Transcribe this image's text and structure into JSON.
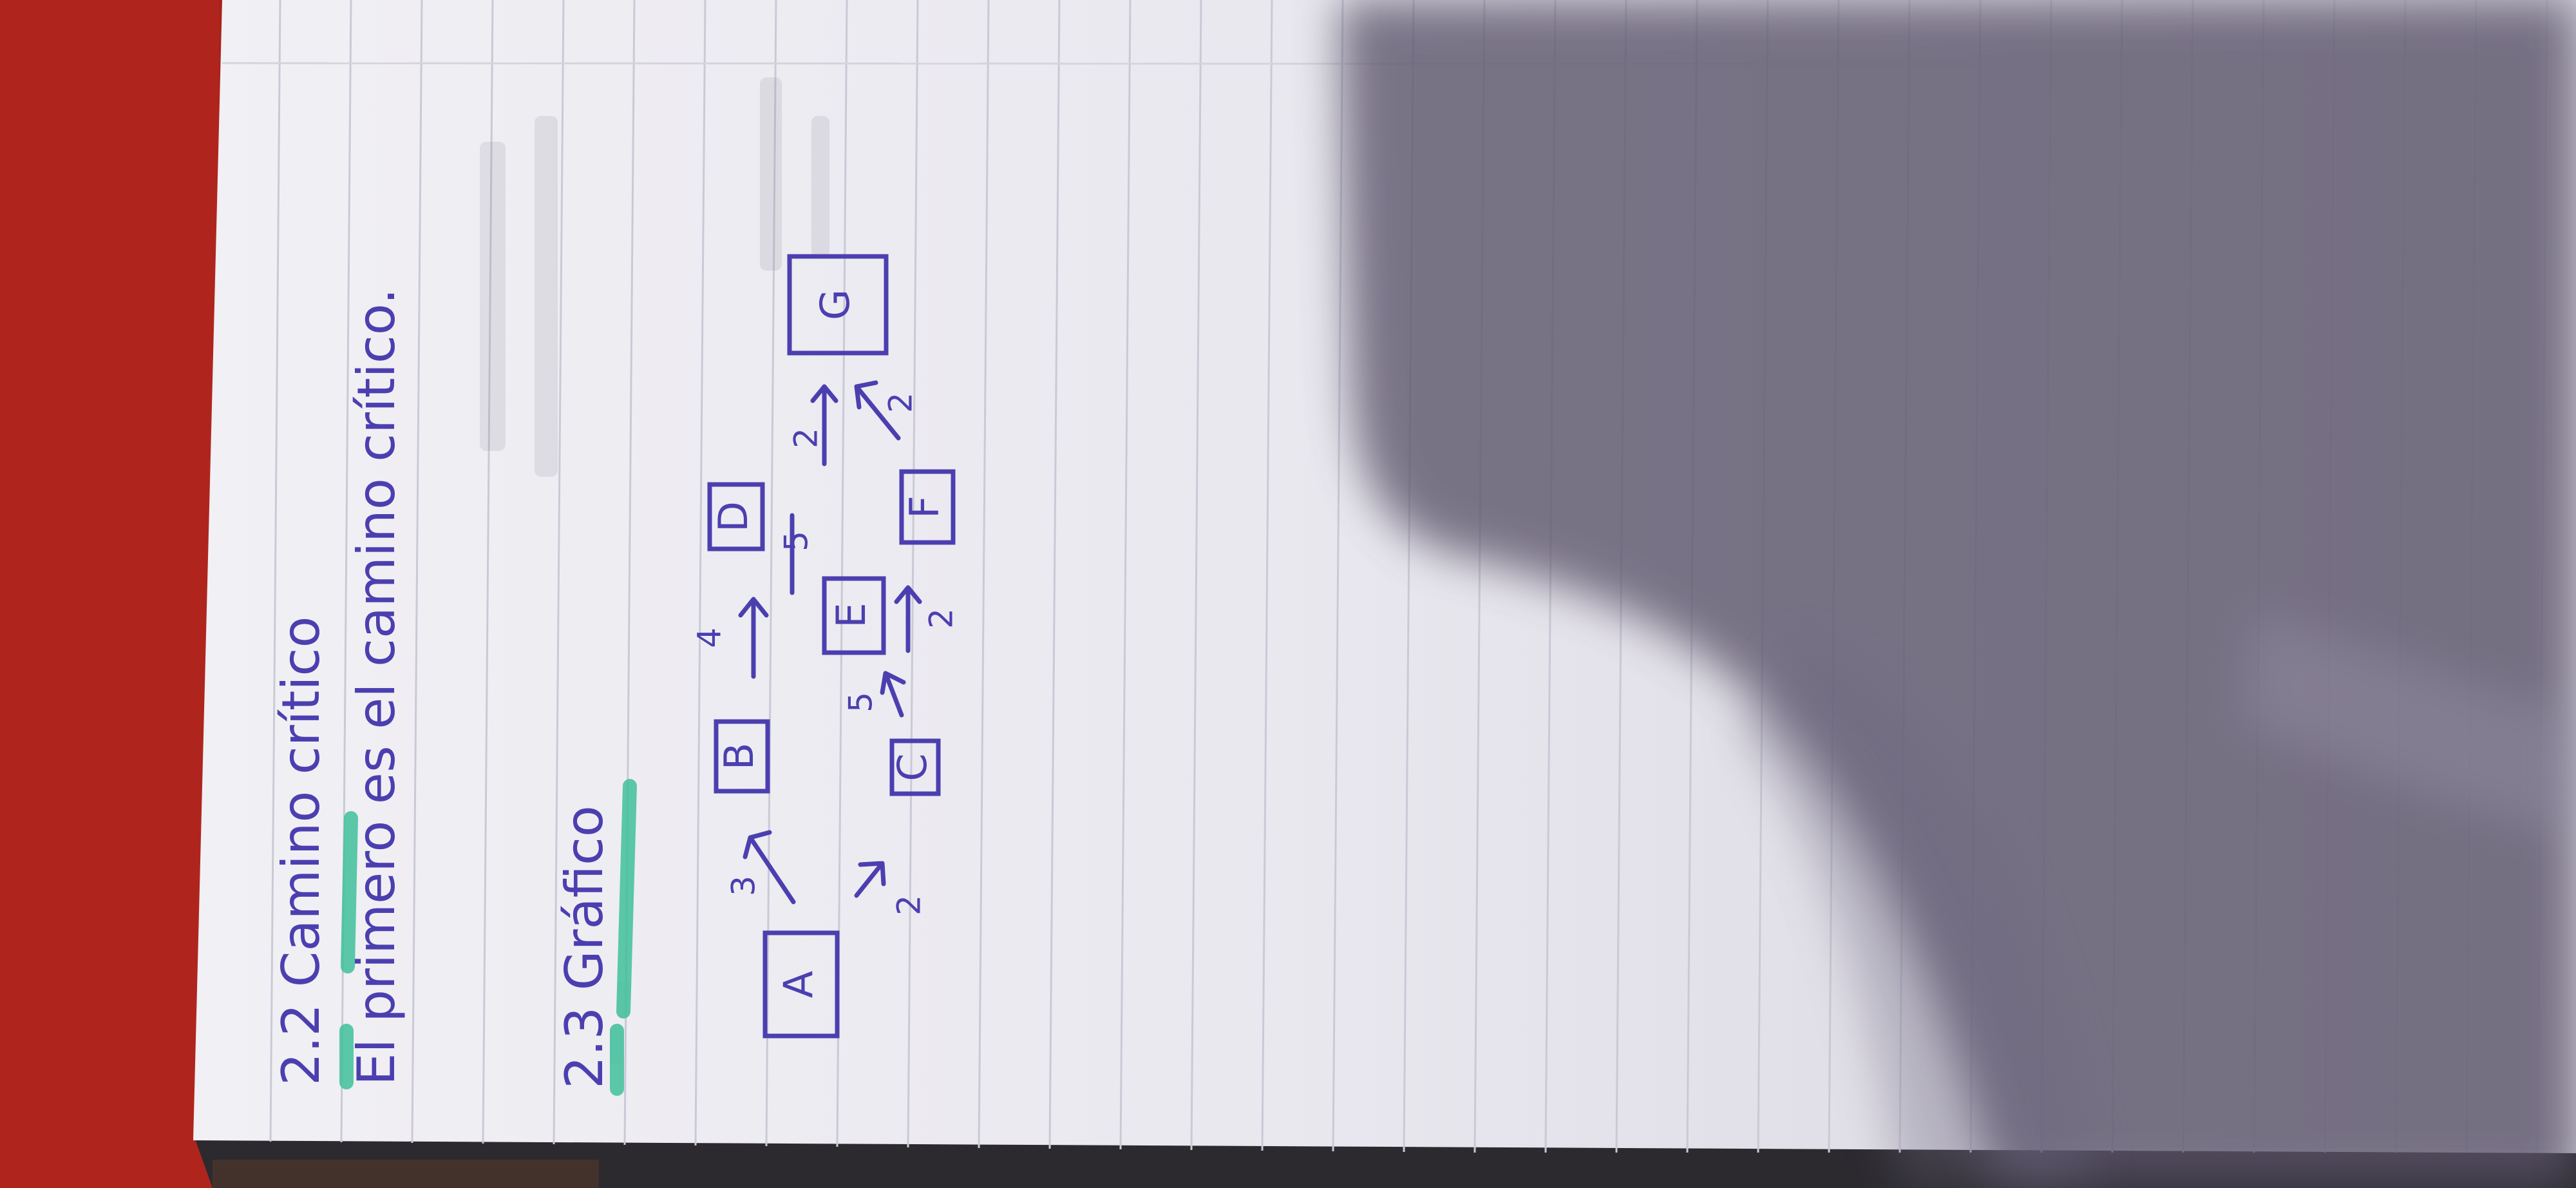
{
  "section_2_2": {
    "heading": "2.2 Camino crítico",
    "sentence": "El primero es el camino crítico."
  },
  "section_2_3": {
    "heading": "2.3 Gráfico"
  },
  "graph": {
    "nodes": [
      "A",
      "B",
      "C",
      "D",
      "E",
      "F",
      "G"
    ],
    "edges": [
      {
        "from": "A",
        "to": "B",
        "weight": "3"
      },
      {
        "from": "A",
        "to": "C",
        "weight": "2"
      },
      {
        "from": "B",
        "to": "D",
        "weight": "4"
      },
      {
        "from": "C",
        "to": "E",
        "weight": "5"
      },
      {
        "from": "C",
        "to": "F",
        "weight": "2"
      },
      {
        "from": "E",
        "to": "D",
        "weight": "5"
      },
      {
        "from": "E",
        "to": "G",
        "weight": "2"
      },
      {
        "from": "F",
        "to": "G",
        "weight": "2"
      }
    ]
  },
  "colors": {
    "table": "#a8221b",
    "paper": "#eeeef3",
    "ink": "#4b3fb0",
    "highlight": "#3fbf9a",
    "shadow": "#5a5369"
  }
}
